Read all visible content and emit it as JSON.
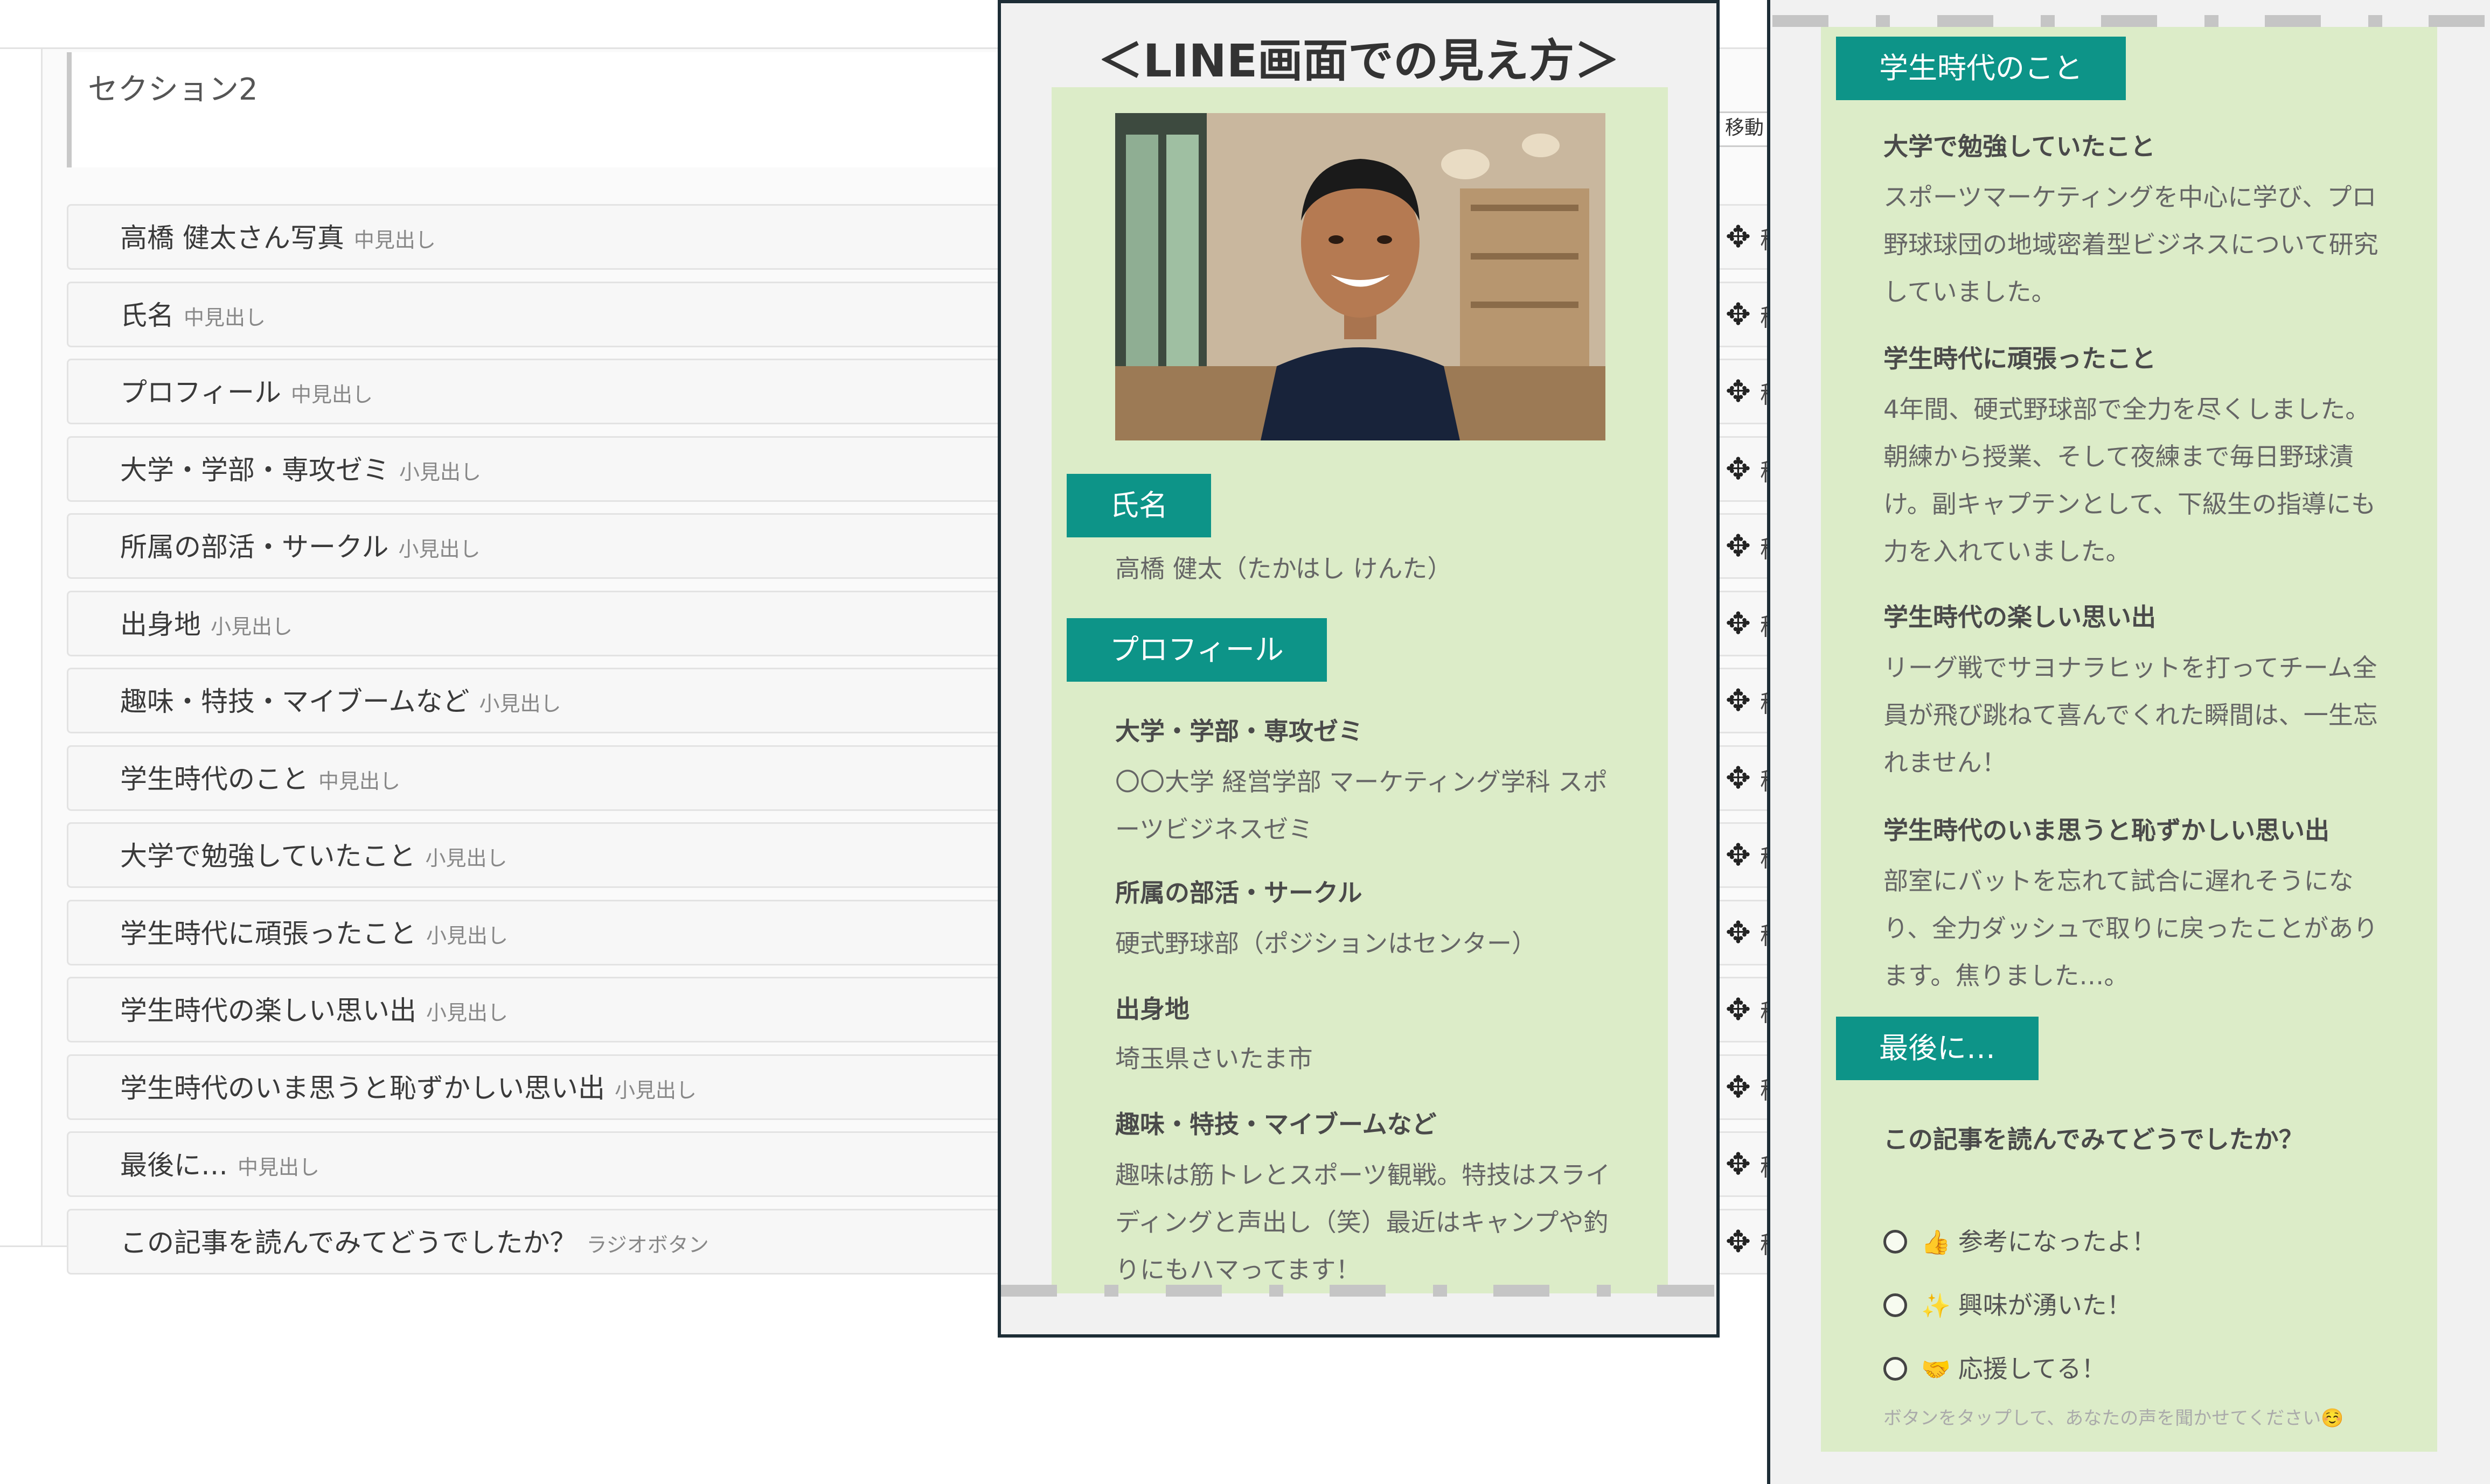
{
  "editor": {
    "section_title": "セクション2",
    "move_label": "移動",
    "move_icon": "move-cross-icon",
    "row_action_label": "移",
    "rows": [
      {
        "title": "高橋 健太さん写真",
        "kind": "中見出し"
      },
      {
        "title": "氏名",
        "kind": "中見出し"
      },
      {
        "title": "プロフィール",
        "kind": "中見出し"
      },
      {
        "title": "大学・学部・専攻ゼミ",
        "kind": "小見出し"
      },
      {
        "title": "所属の部活・サークル",
        "kind": "小見出し"
      },
      {
        "title": "出身地",
        "kind": "小見出し"
      },
      {
        "title": "趣味・特技・マイブームなど",
        "kind": "小見出し"
      },
      {
        "title": "学生時代のこと",
        "kind": "中見出し"
      },
      {
        "title": "大学で勉強していたこと",
        "kind": "小見出し"
      },
      {
        "title": "学生時代に頑張ったこと",
        "kind": "小見出し"
      },
      {
        "title": "学生時代の楽しい思い出",
        "kind": "小見出し"
      },
      {
        "title": "学生時代のいま思うと恥ずかしい思い出",
        "kind": "小見出し"
      },
      {
        "title": "最後に…",
        "kind": "中見出し"
      },
      {
        "title": "この記事を読んでみてどうでしたか？",
        "kind": "ラジオボタン"
      }
    ]
  },
  "preview_title": "＜LINE画面での見え方＞",
  "phone1": {
    "name_heading": "氏名",
    "name_value": "高橋 健太（たかはし けんた）",
    "profile_heading": "プロフィール",
    "items": [
      {
        "label": "大学・学部・専攻ゼミ",
        "text": "〇〇大学 経営学部 マーケティング学科 スポーツビジネスゼミ"
      },
      {
        "label": "所属の部活・サークル",
        "text": "硬式野球部（ポジションはセンター）"
      },
      {
        "label": "出身地",
        "text": "埼玉県さいたま市"
      },
      {
        "label": "趣味・特技・マイブームなど",
        "text": "趣味は筋トレとスポーツ観戦。特技はスライディングと声出し（笑）最近はキャンプや釣りにもハマってます！"
      }
    ]
  },
  "phone2": {
    "student_heading": "学生時代のこと",
    "items": [
      {
        "label": "大学で勉強していたこと",
        "text": "スポーツマーケティングを中心に学び、プロ野球球団の地域密着型ビジネスについて研究していました。"
      },
      {
        "label": "学生時代に頑張ったこと",
        "text": "4年間、硬式野球部で全力を尽くしました。朝練から授業、そして夜練まで毎日野球漬け。副キャプテンとして、下級生の指導にも力を入れていました。"
      },
      {
        "label": "学生時代の楽しい思い出",
        "text": "リーグ戦でサヨナラヒットを打ってチーム全員が飛び跳ねて喜んでくれた瞬間は、一生忘れません！"
      },
      {
        "label": "学生時代のいま思うと恥ずかしい思い出",
        "text": "部室にバットを忘れて試合に遅れそうになり、全力ダッシュで取りに戻ったことがあります。焦りました…。"
      }
    ],
    "last_heading": "最後に…",
    "question": "この記事を読んでみてどうでしたか？",
    "options": [
      {
        "emoji": "👍",
        "label": "参考になったよ！"
      },
      {
        "emoji": "✨",
        "label": "興味が湧いた！"
      },
      {
        "emoji": "🤝",
        "label": "応援してる！"
      }
    ],
    "footnote": "ボタンをタップして、あなたの声を聞かせてください☺️"
  },
  "colors": {
    "accent": "#0d9488",
    "preview_bg": "#dcecc8",
    "frame": "#1d2d36"
  }
}
